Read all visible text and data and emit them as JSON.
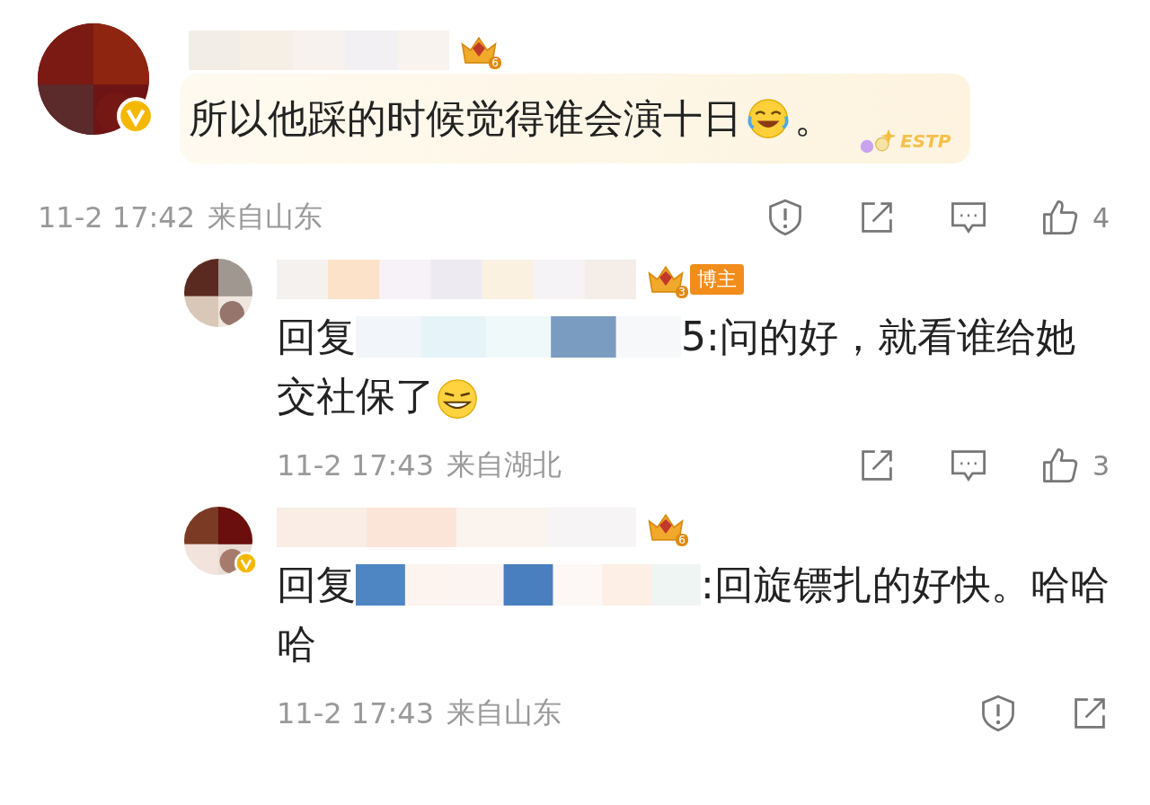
{
  "comments": [
    {
      "kind": "comment",
      "verified": true,
      "level_badge": "6",
      "text": "所以他踩的时候觉得谁会演十日",
      "emoji": {
        "kind": "laugh-cry"
      },
      "text_after_emoji": "。",
      "decoration": "ESTP",
      "time": "11-2 17:42",
      "location": "来自山东",
      "actions": [
        {
          "kind": "report"
        },
        {
          "kind": "share"
        },
        {
          "kind": "comment"
        },
        {
          "kind": "like",
          "count": "4"
        }
      ]
    },
    {
      "kind": "reply",
      "verified": false,
      "level_badge": "3",
      "tag": "博主",
      "reply_prefix": "回复",
      "text": "5:问的好，就看谁给她交社保了",
      "emoji": {
        "kind": "smirk"
      },
      "time": "11-2 17:43",
      "location": "来自湖北",
      "actions": [
        {
          "kind": "share"
        },
        {
          "kind": "comment"
        },
        {
          "kind": "like",
          "count": "3"
        }
      ]
    },
    {
      "kind": "reply",
      "verified": true,
      "level_badge": "6",
      "reply_prefix": "回复",
      "text": ":回旋镖扎的好快。哈哈哈",
      "time": "11-2 17:43",
      "location": "来自山东",
      "actions": [
        {
          "kind": "report"
        },
        {
          "kind": "share"
        }
      ]
    }
  ]
}
